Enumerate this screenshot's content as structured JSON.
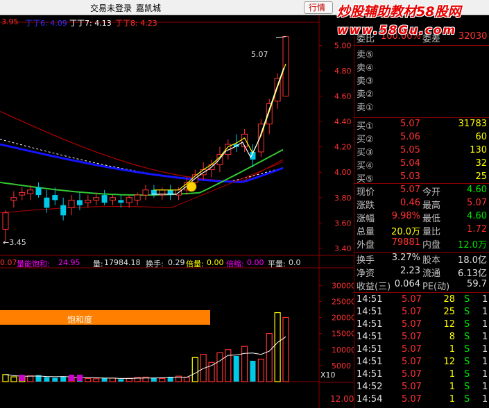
{
  "titlebar": {
    "status_text": "交易未登录",
    "stock_name": "嘉凯城",
    "trade_button": "行情"
  },
  "watermark": {
    "line1": "炒股辅助教材58股网",
    "line2": "www.58Gu.com"
  },
  "ma_labels": [
    {
      "text": "3.95",
      "color": "#ff3232"
    },
    {
      "text": "丁丁6: 4.09",
      "color": "#3232ff"
    },
    {
      "text": "丁丁7: 4.13",
      "color": "#ffffff"
    },
    {
      "text": "丁丁8: 4.23",
      "color": "#ff3232"
    }
  ],
  "price_axis": [
    "5.00",
    "4.80",
    "4.60",
    "4.40",
    "4.20",
    "4.00",
    "3.80",
    "3.60",
    "3.40"
  ],
  "chart_labels": {
    "high_mark": "5.07",
    "low_mark": "←3.45",
    "saturation_label": "饱和度"
  },
  "indicator_bar": {
    "value1": "0.07",
    "sat_label": "量能饱和:",
    "sat_value": "24.95",
    "vol_label": "量:",
    "vol_value": "17984.18",
    "turnover_label": "换手:",
    "turnover_value": "0.29",
    "multiple_label": "倍量:",
    "multiple_value": "0.00",
    "shrink_label": "倍缩:",
    "shrink_value": "0.00",
    "flat_label": "平量:",
    "flat_value": "0.0"
  },
  "volume_axis": [
    "30000",
    "25000",
    "20000",
    "15000",
    "10000",
    "5000"
  ],
  "volume_unit": "X10",
  "bottom_axis": "12.00",
  "quote": {
    "top_row": {
      "label1": "委比",
      "val1": "100.00%",
      "label2": "委差",
      "val2": "32030"
    },
    "sell": [
      {
        "label": "卖⑤"
      },
      {
        "label": "卖④"
      },
      {
        "label": "卖③"
      },
      {
        "label": "卖②"
      },
      {
        "label": "卖①"
      }
    ],
    "buy": [
      {
        "label": "买①",
        "price": "5.07",
        "vol": "31783"
      },
      {
        "label": "买②",
        "price": "5.06",
        "vol": "60"
      },
      {
        "label": "买③",
        "price": "5.05",
        "vol": "130"
      },
      {
        "label": "买④",
        "price": "5.04",
        "vol": "32"
      },
      {
        "label": "买⑤",
        "price": "5.03",
        "vol": "25"
      }
    ],
    "stats": [
      {
        "l1": "现价",
        "v1": "5.07",
        "c1": "red",
        "l2": "今开",
        "v2": "4.60",
        "c2": "green"
      },
      {
        "l1": "涨跌",
        "v1": "0.46",
        "c1": "red",
        "l2": "最高",
        "v2": "5.07",
        "c2": "red"
      },
      {
        "l1": "涨幅",
        "v1": "9.98%",
        "c1": "red",
        "l2": "最低",
        "v2": "4.60",
        "c2": "green"
      },
      {
        "l1": "总量",
        "v1": "20.0万",
        "c1": "yellow",
        "l2": "量比",
        "v2": "1.72",
        "c2": "red"
      },
      {
        "l1": "外盘",
        "v1": "79881",
        "c1": "red",
        "l2": "内盘",
        "v2": "12.0万",
        "c2": "green"
      }
    ],
    "stats2": [
      {
        "l1": "换手",
        "v1": "3.27%",
        "l2": "股本",
        "v2": "18.0亿"
      },
      {
        "l1": "净资",
        "v1": "2.23",
        "l2": "流通",
        "v2": "6.13亿"
      },
      {
        "l1": "收益(三)",
        "v1": "0.064",
        "l2": "PE(动)",
        "v2": "59.7"
      }
    ],
    "ticks": [
      {
        "time": "14:51",
        "price": "5.07",
        "vol": "28",
        "side": "S",
        "n": "1"
      },
      {
        "time": "14:51",
        "price": "5.07",
        "vol": "25",
        "side": "S",
        "n": "1"
      },
      {
        "time": "14:51",
        "price": "5.07",
        "vol": "12",
        "side": "S",
        "n": "1"
      },
      {
        "time": "14:51",
        "price": "5.07",
        "vol": "8",
        "side": "S",
        "n": "1"
      },
      {
        "time": "14:51",
        "price": "5.07",
        "vol": "1",
        "side": "S",
        "n": "1"
      },
      {
        "time": "14:51",
        "price": "5.07",
        "vol": "12",
        "side": "S",
        "n": "1"
      },
      {
        "time": "14:51",
        "price": "5.07",
        "vol": "1",
        "side": "S",
        "n": "1"
      },
      {
        "time": "14:52",
        "price": "5.07",
        "vol": "1",
        "side": "S",
        "n": "1"
      },
      {
        "time": "14:54",
        "price": "5.07",
        "vol": "1",
        "side": "S",
        "n": "1"
      }
    ]
  },
  "colors": {
    "up": "#ff3232",
    "down": "#00c8e6",
    "grid": "#8b0000",
    "ma_white": "#ffffff",
    "ma_yellow": "#ffff00",
    "ma_green": "#32c832",
    "ma_blue": "#1414ff",
    "ma_red": "#b40000",
    "saturation_bar": "#ff8000"
  },
  "chart_data": {
    "type": "candlestick",
    "ylim": [
      3.35,
      5.15
    ],
    "candles": [
      {
        "o": 3.55,
        "h": 3.7,
        "l": 3.45,
        "c": 3.68
      },
      {
        "o": 3.78,
        "h": 3.85,
        "l": 3.72,
        "c": 3.8
      },
      {
        "o": 3.82,
        "h": 3.88,
        "l": 3.78,
        "c": 3.84
      },
      {
        "o": 3.83,
        "h": 3.9,
        "l": 3.78,
        "c": 3.86
      },
      {
        "o": 3.88,
        "h": 3.92,
        "l": 3.8,
        "c": 3.82
      },
      {
        "o": 3.8,
        "h": 3.86,
        "l": 3.68,
        "c": 3.72
      },
      {
        "o": 3.82,
        "h": 3.88,
        "l": 3.74,
        "c": 3.78
      },
      {
        "o": 3.74,
        "h": 3.8,
        "l": 3.62,
        "c": 3.66
      },
      {
        "o": 3.72,
        "h": 3.82,
        "l": 3.66,
        "c": 3.78
      },
      {
        "o": 3.78,
        "h": 3.84,
        "l": 3.7,
        "c": 3.74
      },
      {
        "o": 3.76,
        "h": 3.82,
        "l": 3.72,
        "c": 3.78
      },
      {
        "o": 3.78,
        "h": 3.84,
        "l": 3.74,
        "c": 3.8
      },
      {
        "o": 3.82,
        "h": 3.86,
        "l": 3.74,
        "c": 3.76
      },
      {
        "o": 3.78,
        "h": 3.82,
        "l": 3.74,
        "c": 3.8
      },
      {
        "o": 3.78,
        "h": 3.82,
        "l": 3.72,
        "c": 3.76
      },
      {
        "o": 3.76,
        "h": 3.82,
        "l": 3.72,
        "c": 3.8
      },
      {
        "o": 3.78,
        "h": 3.84,
        "l": 3.74,
        "c": 3.82
      },
      {
        "o": 3.82,
        "h": 3.9,
        "l": 3.78,
        "c": 3.86
      },
      {
        "o": 3.86,
        "h": 3.9,
        "l": 3.8,
        "c": 3.82
      },
      {
        "o": 3.82,
        "h": 3.88,
        "l": 3.78,
        "c": 3.86
      },
      {
        "o": 3.86,
        "h": 3.9,
        "l": 3.78,
        "c": 3.82
      },
      {
        "o": 3.82,
        "h": 3.88,
        "l": 3.78,
        "c": 3.86
      },
      {
        "o": 3.86,
        "h": 3.96,
        "l": 3.82,
        "c": 3.92
      },
      {
        "o": 3.92,
        "h": 4.02,
        "l": 3.88,
        "c": 3.98
      },
      {
        "o": 3.98,
        "h": 4.08,
        "l": 3.94,
        "c": 4.02
      },
      {
        "o": 4.02,
        "h": 4.1,
        "l": 3.96,
        "c": 4.06
      },
      {
        "o": 4.06,
        "h": 4.2,
        "l": 4.0,
        "c": 4.14
      },
      {
        "o": 4.14,
        "h": 4.26,
        "l": 4.1,
        "c": 4.22
      },
      {
        "o": 4.22,
        "h": 4.3,
        "l": 4.16,
        "c": 4.2
      },
      {
        "o": 4.2,
        "h": 4.34,
        "l": 4.16,
        "c": 4.3
      },
      {
        "o": 4.16,
        "h": 4.22,
        "l": 4.04,
        "c": 4.1
      },
      {
        "o": 4.16,
        "h": 4.42,
        "l": 4.12,
        "c": 4.38
      },
      {
        "o": 4.38,
        "h": 4.58,
        "l": 4.3,
        "c": 4.54
      },
      {
        "o": 4.56,
        "h": 4.78,
        "l": 4.5,
        "c": 4.74
      },
      {
        "o": 4.6,
        "h": 5.07,
        "l": 4.6,
        "c": 5.07
      }
    ],
    "volume": [
      2200,
      1500,
      1300,
      1800,
      2000,
      1400,
      1200,
      1600,
      1100,
      1300,
      1000,
      900,
      1200,
      1100,
      800,
      1000,
      1300,
      1400,
      1200,
      1000,
      1500,
      1700,
      1400,
      7500,
      8500,
      6000,
      9000,
      10000,
      8000,
      11000,
      6500,
      7000,
      15000,
      21500,
      20000
    ]
  }
}
